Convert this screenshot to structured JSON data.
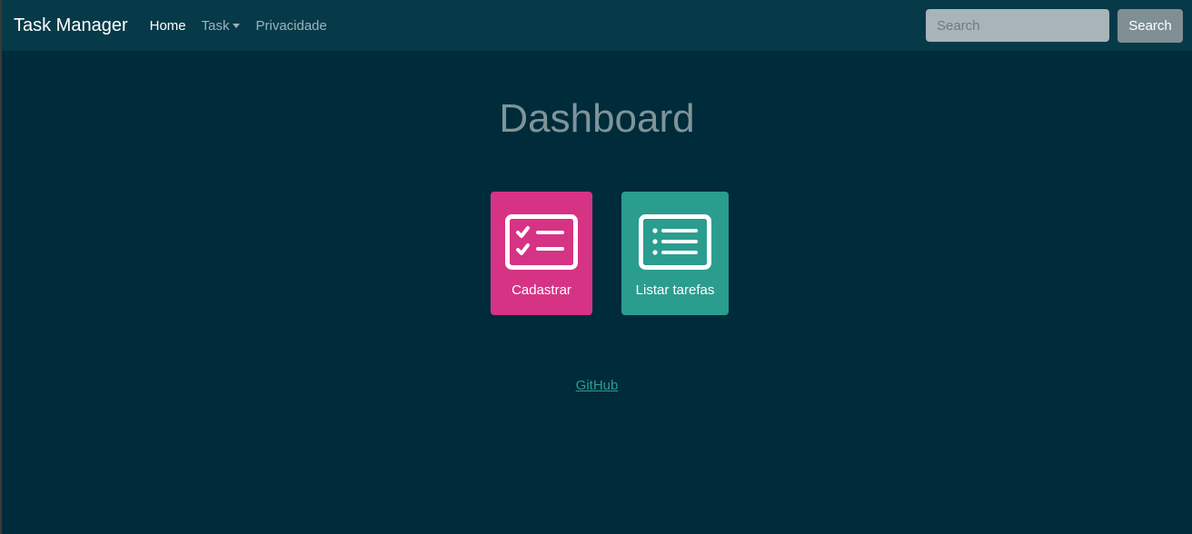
{
  "navbar": {
    "brand": "Task Manager",
    "links": [
      {
        "label": "Home",
        "active": true
      },
      {
        "label": "Task",
        "dropdown": true
      },
      {
        "label": "Privacidade"
      }
    ],
    "search_placeholder": "Search",
    "search_button": "Search"
  },
  "main": {
    "title": "Dashboard",
    "tiles": [
      {
        "label": "Cadastrar",
        "icon": "checklist-icon",
        "color": "#d63384"
      },
      {
        "label": "Listar tarefas",
        "icon": "list-icon",
        "color": "#2a9d8f"
      }
    ]
  },
  "footer": {
    "link_label": "GitHub"
  },
  "colors": {
    "background": "#002b3a",
    "navbar": "#073a48",
    "accent_pink": "#d63384",
    "accent_teal": "#2a9d8f"
  }
}
